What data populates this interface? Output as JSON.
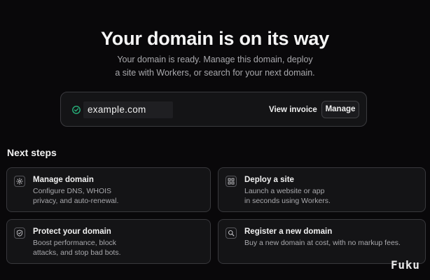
{
  "hero": {
    "title": "Your domain is on its way",
    "subtitle_line1": "Your domain is ready. Manage this domain, deploy",
    "subtitle_line2": "a site with Workers, or search for your next domain."
  },
  "domain_bar": {
    "domain": "example.com",
    "status_icon": "check-circle-icon",
    "view_invoice_label": "View invoice",
    "manage_label": "Manage"
  },
  "next_steps": {
    "heading": "Next steps",
    "cards": [
      {
        "icon": "gear-icon",
        "title": "Manage domain",
        "desc_line1": "Configure DNS, WHOIS",
        "desc_line2": "privacy, and auto-renewal."
      },
      {
        "icon": "grid-icon",
        "title": "Deploy a site",
        "desc_line1": "Launch a website or app",
        "desc_line2": "in seconds using Workers."
      },
      {
        "icon": "shield-icon",
        "title": "Protect your domain",
        "desc_line1": "Boost performance, block",
        "desc_line2": "attacks, and stop bad bots."
      },
      {
        "icon": "search-icon",
        "title": "Register a new domain",
        "desc_line1": "Buy a new domain at cost, with no markup fees.",
        "desc_line2": ""
      }
    ]
  },
  "watermark": "Fuku",
  "colors": {
    "background": "#09080a",
    "card": "#141416",
    "border": "#38383c",
    "success": "#27b07a",
    "muted_text": "#a9a9ad"
  }
}
